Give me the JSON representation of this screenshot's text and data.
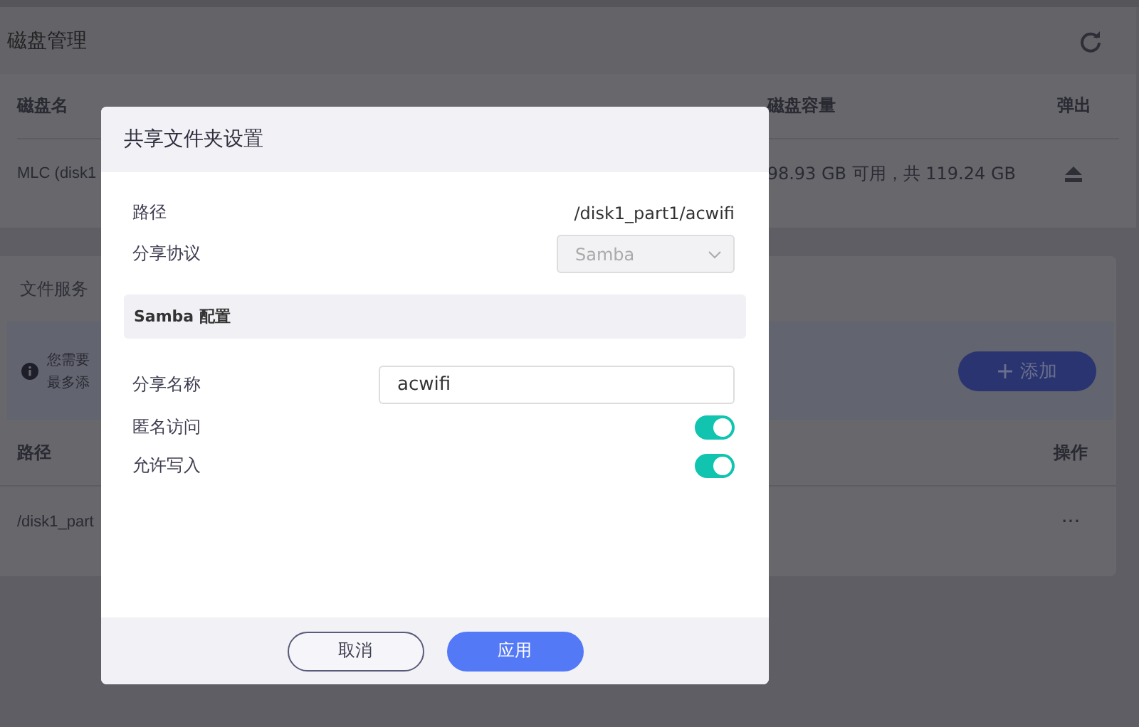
{
  "page": {
    "title": "磁盘管理",
    "disk_table": {
      "columns": [
        "磁盘名",
        "磁盘容量",
        "弹出"
      ],
      "rows": [
        {
          "name": "MLC (disk1",
          "capacity": "98.93 GB 可用，共 119.24 GB"
        }
      ]
    },
    "tab": "文件服务",
    "notice": [
      "您需要",
      "最多添"
    ],
    "add_button": "添加",
    "share_table": {
      "columns": [
        "路径",
        "操作"
      ],
      "rows": [
        {
          "path": "/disk1_part",
          "actions": "···"
        }
      ]
    }
  },
  "dialog": {
    "title": "共享文件夹设置",
    "fields": [
      {
        "kind": "text",
        "label": "路径",
        "value": "/disk1_part1/acwifi"
      },
      {
        "kind": "select",
        "label": "分享协议",
        "value": "Samba",
        "disabled": true
      }
    ],
    "section": "Samba 配置",
    "settings": [
      {
        "kind": "input",
        "label": "分享名称",
        "value": "acwifi"
      },
      {
        "kind": "toggle",
        "label": "匿名访问",
        "on": true
      },
      {
        "kind": "toggle",
        "label": "允许写入",
        "on": true
      }
    ],
    "buttons": [
      {
        "label": "取消",
        "primary": false
      },
      {
        "label": "应用",
        "primary": true
      }
    ]
  }
}
